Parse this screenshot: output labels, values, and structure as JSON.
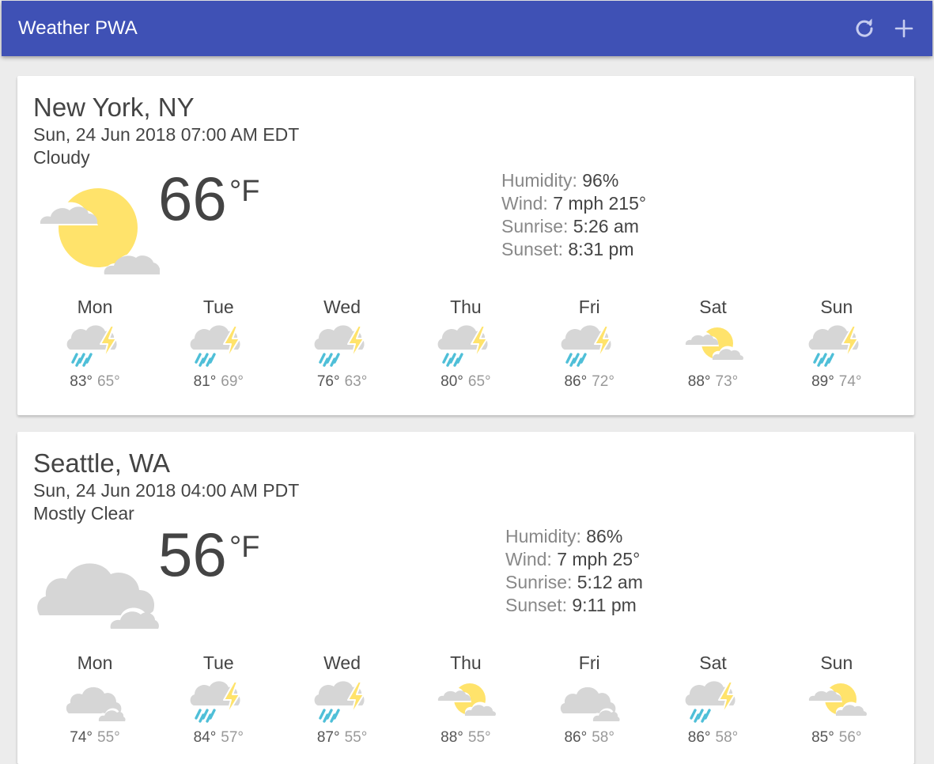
{
  "app": {
    "title": "Weather PWA",
    "refresh_icon": "refresh-icon",
    "add_icon": "plus-icon"
  },
  "colors": {
    "header": "#3f51b5",
    "sun": "#ffe36b",
    "cloud": "#d6d6d6",
    "rain": "#4fbfd8",
    "bolt": "#ffe36b"
  },
  "cards": [
    {
      "location": "New York, NY",
      "date": "Sun, 24 Jun 2018 07:00 AM EDT",
      "description": "Cloudy",
      "icon": "partly-cloudy",
      "temperature": "66",
      "scale": "°F",
      "details": {
        "humidity_label": "Humidity:",
        "humidity": "96%",
        "wind_label": "Wind:",
        "wind": "7 mph 215°",
        "sunrise_label": "Sunrise:",
        "sunrise": "5:26 am",
        "sunset_label": "Sunset:",
        "sunset": "8:31 pm"
      },
      "forecast": [
        {
          "day": "Mon",
          "icon": "thunderstorms",
          "high": "83°",
          "low": "65°"
        },
        {
          "day": "Tue",
          "icon": "thunderstorms",
          "high": "81°",
          "low": "69°"
        },
        {
          "day": "Wed",
          "icon": "thunderstorms",
          "high": "76°",
          "low": "63°"
        },
        {
          "day": "Thu",
          "icon": "thunderstorms",
          "high": "80°",
          "low": "65°"
        },
        {
          "day": "Fri",
          "icon": "thunderstorms",
          "high": "86°",
          "low": "72°"
        },
        {
          "day": "Sat",
          "icon": "partly-cloudy",
          "high": "88°",
          "low": "73°"
        },
        {
          "day": "Sun",
          "icon": "thunderstorms",
          "high": "89°",
          "low": "74°"
        }
      ]
    },
    {
      "location": "Seattle, WA",
      "date": "Sun, 24 Jun 2018 04:00 AM PDT",
      "description": "Mostly Clear",
      "icon": "cloudy",
      "temperature": "56",
      "scale": "°F",
      "details": {
        "humidity_label": "Humidity:",
        "humidity": "86%",
        "wind_label": "Wind:",
        "wind": "7 mph 25°",
        "sunrise_label": "Sunrise:",
        "sunrise": "5:12 am",
        "sunset_label": "Sunset:",
        "sunset": "9:11 pm"
      },
      "forecast": [
        {
          "day": "Mon",
          "icon": "cloudy",
          "high": "74°",
          "low": "55°"
        },
        {
          "day": "Tue",
          "icon": "thunderstorms",
          "high": "84°",
          "low": "57°"
        },
        {
          "day": "Wed",
          "icon": "thunderstorms",
          "high": "87°",
          "low": "55°"
        },
        {
          "day": "Thu",
          "icon": "partly-cloudy",
          "high": "88°",
          "low": "55°"
        },
        {
          "day": "Fri",
          "icon": "cloudy",
          "high": "86°",
          "low": "58°"
        },
        {
          "day": "Sat",
          "icon": "thunderstorms",
          "high": "86°",
          "low": "58°"
        },
        {
          "day": "Sun",
          "icon": "partly-cloudy",
          "high": "85°",
          "low": "56°"
        }
      ]
    }
  ]
}
